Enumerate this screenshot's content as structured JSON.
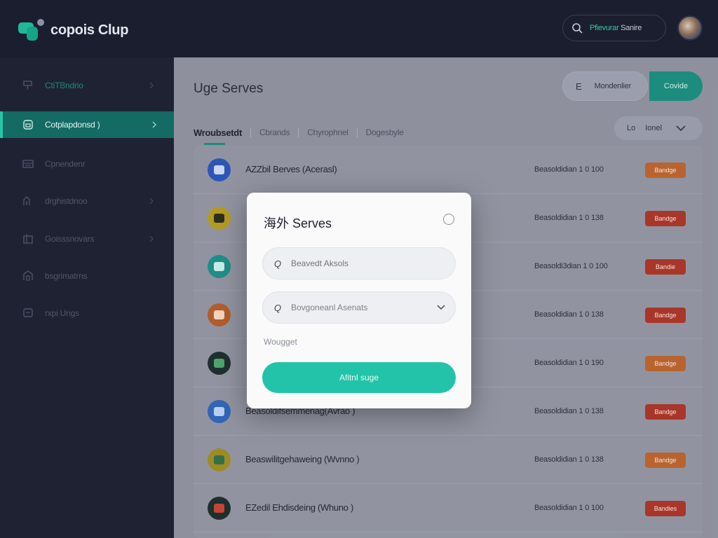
{
  "app": {
    "logo_text": "copois Clup",
    "logo_icon": "app-logo-icon",
    "brand_color": "#25c7a6"
  },
  "header": {
    "search": {
      "label_accent": "Pfievurar",
      "label_rest": "Sanire",
      "icon": "search-icon"
    },
    "avatar": "user-avatar"
  },
  "sidebar": {
    "items": [
      {
        "label": "CtiTBndrio",
        "icon": "pin-icon",
        "active": false
      },
      {
        "label": "Cotplapdonsd )",
        "icon": "folder-icon",
        "active": true
      },
      {
        "label": "Cpnendenr",
        "icon": "list-icon",
        "active": false
      },
      {
        "label": "drghistdnoo",
        "icon": "chart-icon",
        "active": false
      },
      {
        "label": "Goisssnovars",
        "icon": "box-icon",
        "active": false
      },
      {
        "label": "bsgrimatrns",
        "icon": "building-icon",
        "active": false
      },
      {
        "label": "rxpi Ungs",
        "icon": "message-icon",
        "active": false
      }
    ]
  },
  "main": {
    "title": "Uge Serves",
    "buttons": {
      "outline_glyph": "E",
      "outline_label": "Mondenlier",
      "primary_label": "Covide"
    },
    "tabs": [
      "Wroubsetdt",
      "Cbrands",
      "Chyrophnel",
      "Dogesbyle"
    ],
    "filter": {
      "glyph": "Lo",
      "label": "Ionel"
    },
    "rows": [
      {
        "name": "AZZbil Berves (Acerasl)",
        "meta": "Beasoldidian 1  0 100",
        "badge": "Bandge",
        "icon_color": "#2853b5",
        "inner_color": "#c9d5f5",
        "badge_color": "#b8612c"
      },
      {
        "name": "",
        "meta": "Beasoldidian 1  0 138",
        "badge": "Bandge",
        "icon_color": "#b19a1f",
        "inner_color": "#2a2a1c",
        "badge_color": "#a83226"
      },
      {
        "name": "",
        "meta": "Beasoldi3dian 1  0 100",
        "badge": "Bandie",
        "icon_color": "#1c8c86",
        "inner_color": "#c8ece6",
        "badge_color": "#a83226"
      },
      {
        "name": "",
        "meta": "Beasoldidian 1  0 138",
        "badge": "Bandge",
        "icon_color": "#b15a28",
        "inner_color": "#f2d4bf",
        "badge_color": "#a83226"
      },
      {
        "name": "",
        "meta": "Beasoldidian 1  0 190",
        "badge": "Bandge",
        "icon_color": "#1b2c2a",
        "inner_color": "#4aa36b",
        "badge_color": "#b8612c"
      },
      {
        "name": "Beasoldifsemmenag(Avrao )",
        "meta": "Beasoldidian 1  0 138",
        "badge": "Bandge",
        "icon_color": "#2c62b8",
        "inner_color": "#b9d0ef",
        "badge_color": "#a83226"
      },
      {
        "name": "Beaswilitgehaweing (Wvnno )",
        "meta": "Beasoldidian 1  0 138",
        "badge": "Bandge",
        "icon_color": "#9c8a22",
        "inner_color": "#2e6e44",
        "badge_color": "#b8612c"
      },
      {
        "name": "EZedil Ehdisdeing (Whuno )",
        "meta": "Beasoldidian 1  0 100",
        "badge": "Bandies",
        "icon_color": "#1a2b2a",
        "inner_color": "#c2432e",
        "badge_color": "#a83226"
      }
    ]
  },
  "modal": {
    "title": "海外 Serves",
    "field1": {
      "glyph": "Q",
      "placeholder": "Beavedt Aksols"
    },
    "field2": {
      "glyph": "Q",
      "value": "Bovgoneanl Asenats"
    },
    "label": "Wougget",
    "submit": "Afitnl suge",
    "accent": "#22c3a9"
  }
}
